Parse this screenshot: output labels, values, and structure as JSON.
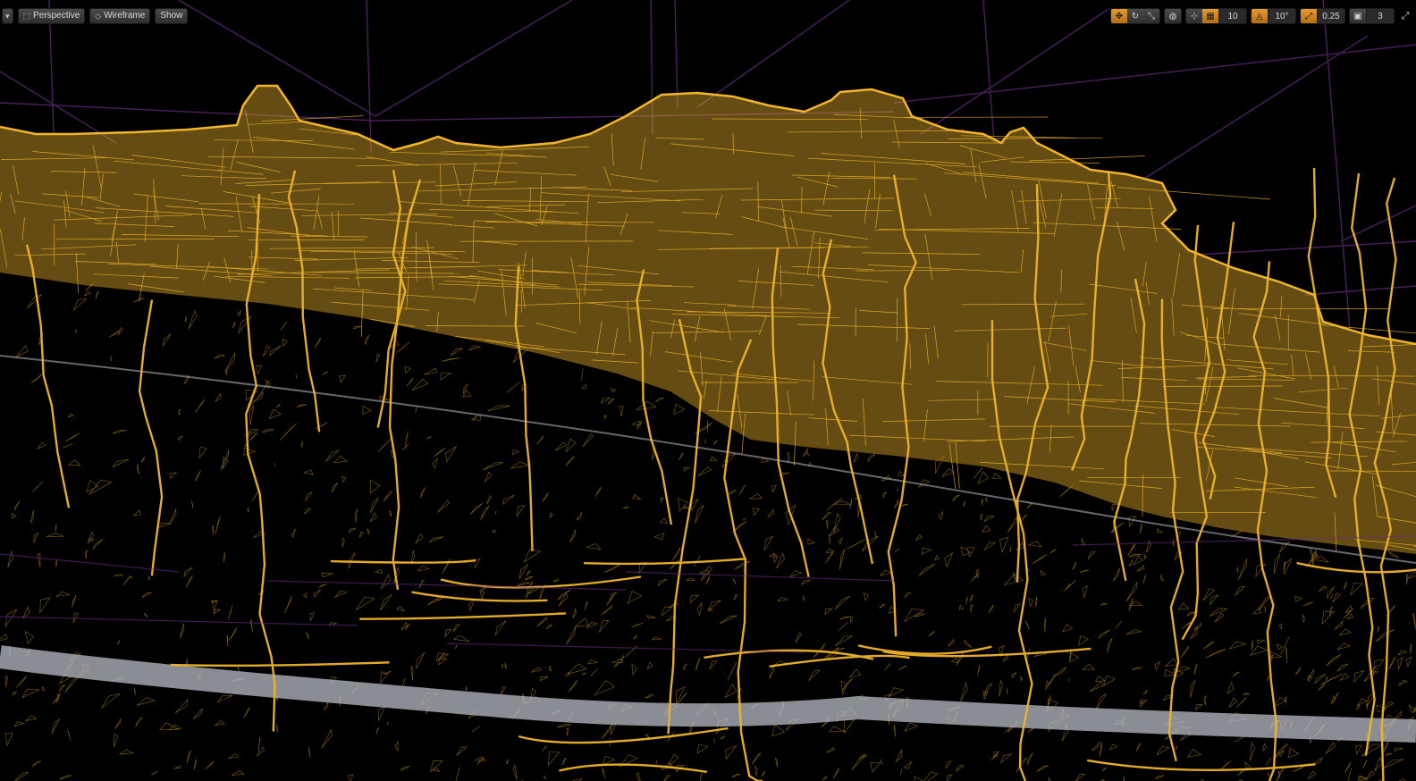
{
  "toolbar_left": {
    "menu_icon": "chevron-down-icon",
    "perspective_label": "Perspective",
    "wireframe_label": "Wireframe",
    "show_label": "Show"
  },
  "toolbar_right": {
    "grid_snap_value": "10",
    "rotation_snap_value": "10°",
    "scale_snap_value": "0.25",
    "camera_speed_value": "3"
  },
  "colors": {
    "background": "#000000",
    "mesh_yellow": "#f0b52a",
    "mesh_dark_yellow": "#b8861a",
    "mesh_gray": "#b9bcc6",
    "grid_purple": "#4a1f5c",
    "accent_orange": "#e39a32"
  }
}
